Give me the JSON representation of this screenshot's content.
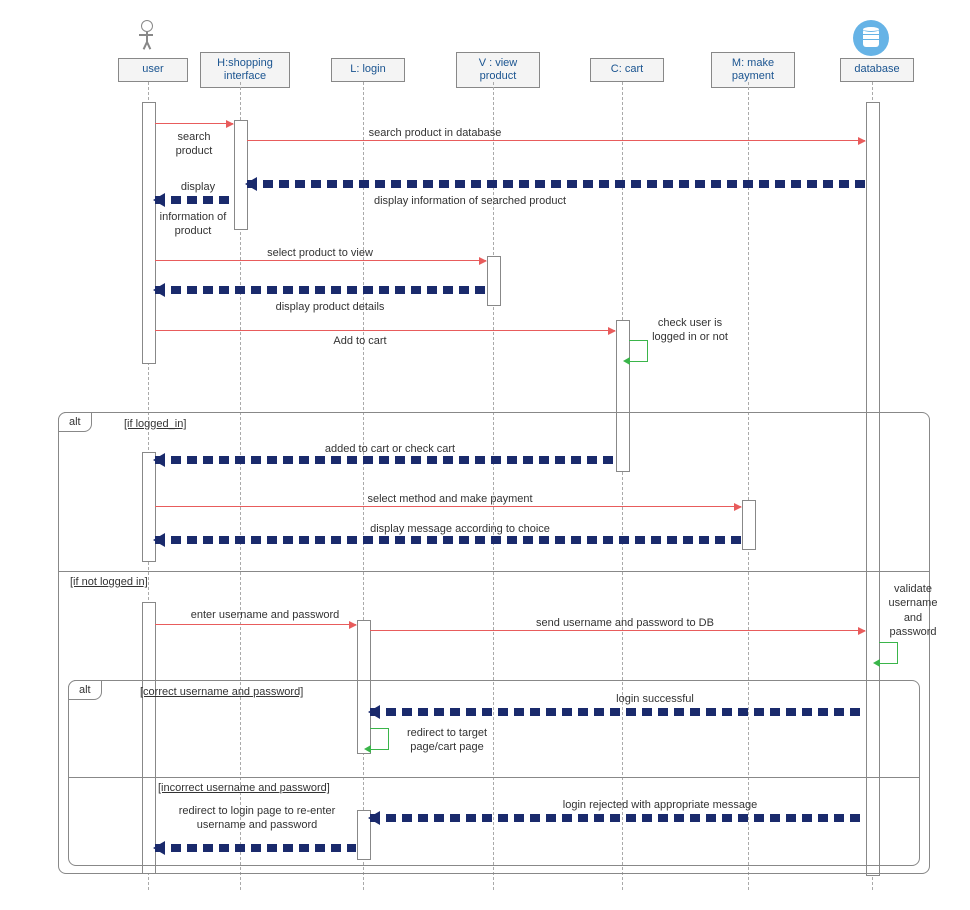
{
  "participants": {
    "user": "user",
    "shopping": "H:shopping interface",
    "login": "L: login",
    "view": "V : view product",
    "cart": "C: cart",
    "payment": "M: make payment",
    "db": "database"
  },
  "messages": {
    "m1": "search product",
    "m2": "search product in database",
    "m3": "display information of searched product",
    "m4a": "display",
    "m4b": "information of product",
    "m5": "select product to view",
    "m6": "display product details",
    "m7": "Add to cart",
    "m8": "check user is logged in or not",
    "m9": "added to cart or check cart",
    "m10": "select method and make payment",
    "m11": "display message according to choice",
    "m12": "enter username and password",
    "m13": "send username and password to DB",
    "m14": "validate username and password",
    "m15": "login successful",
    "m16": "redirect to target page/cart page",
    "m17": "login rejected with appropriate message",
    "m18": "redirect to login page to re-enter username and password"
  },
  "fragments": {
    "alt1": "alt",
    "guard1": "[if logged_in]",
    "guard2": "[if not logged in]",
    "alt2": "alt",
    "guard3": "[correct username and password]",
    "guard4": "[incorrect username and password]"
  }
}
